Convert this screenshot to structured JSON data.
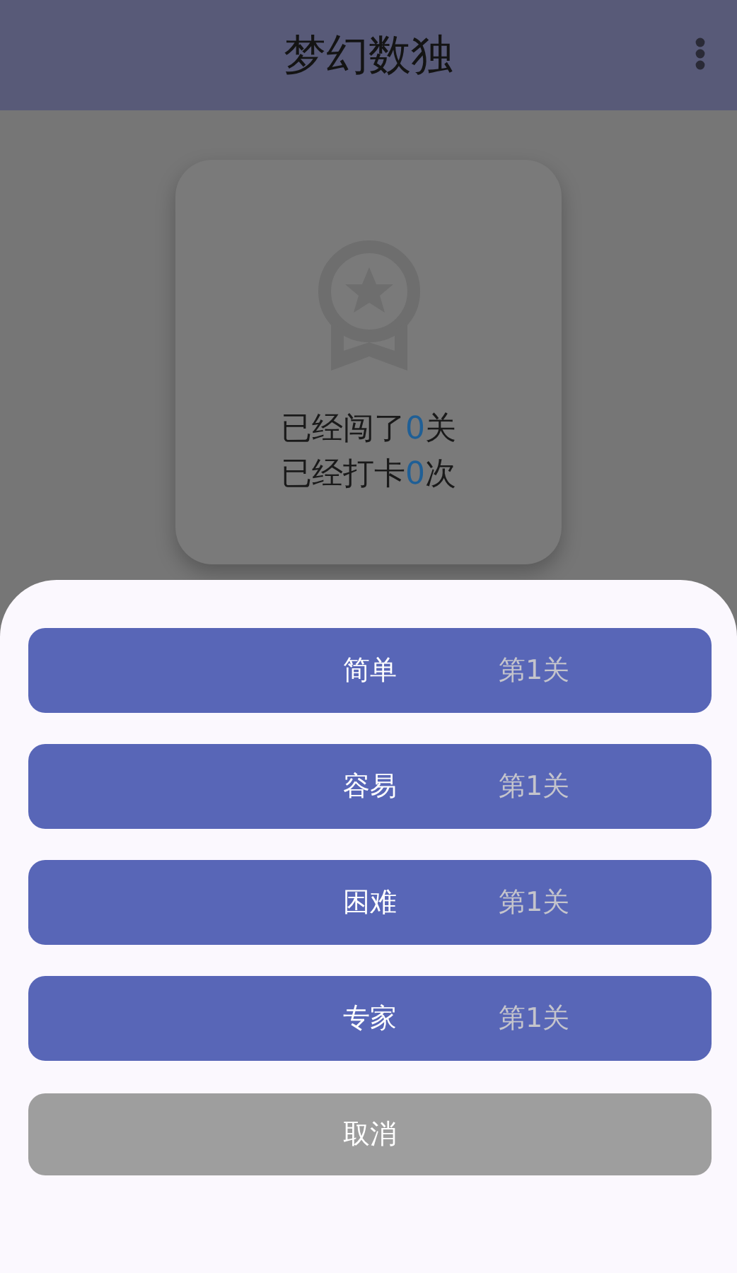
{
  "app_bar": {
    "title": "梦幻数独"
  },
  "stats_card": {
    "lines": [
      {
        "prefix": "已经闯了",
        "count": "0",
        "suffix": "关"
      },
      {
        "prefix": "已经打卡",
        "count": "0",
        "suffix": "次"
      }
    ]
  },
  "bottom_sheet": {
    "options": [
      {
        "label": "简单",
        "level": "第1关"
      },
      {
        "label": "容易",
        "level": "第1关"
      },
      {
        "label": "困难",
        "level": "第1关"
      },
      {
        "label": "专家",
        "level": "第1关"
      }
    ],
    "cancel": "取消"
  }
}
